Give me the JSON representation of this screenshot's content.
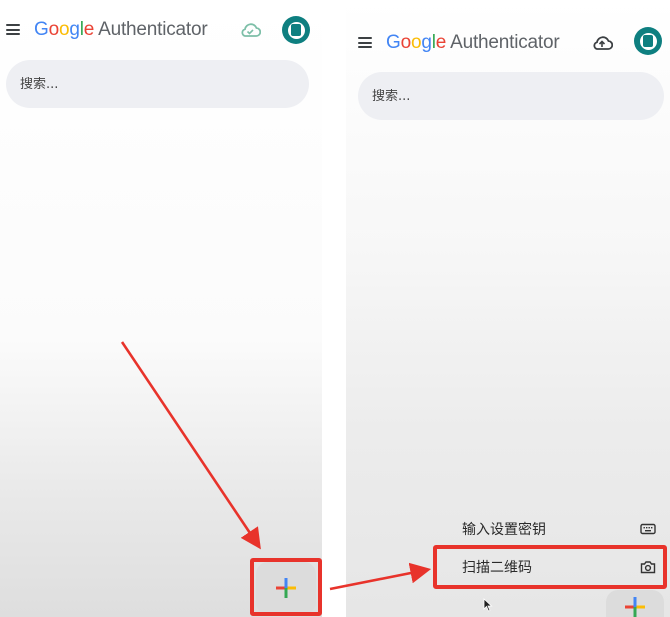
{
  "app": {
    "logo_letters": [
      "G",
      "o",
      "o",
      "g",
      "l",
      "e"
    ],
    "app_name": "Authenticator"
  },
  "left": {
    "search_placeholder": "搜索..."
  },
  "right": {
    "search_placeholder": "搜索...",
    "fab_menu": [
      {
        "label": "输入设置密钥",
        "icon": "keyboard-icon"
      },
      {
        "label": "扫描二维码",
        "icon": "camera-icon"
      }
    ]
  },
  "colors": {
    "accent_teal": "#0e7f80",
    "highlight_red": "#e8332b",
    "search_bg": "#eeeff3",
    "plus_blue": "#4285f4",
    "plus_red": "#ea4335",
    "plus_yellow": "#fbbc05",
    "plus_green": "#34a853"
  },
  "icons": [
    "menu-icon",
    "cloud-sync-icon",
    "plus-icon",
    "keyboard-icon",
    "camera-icon",
    "mouse-cursor-icon",
    "arrow-annotation"
  ]
}
